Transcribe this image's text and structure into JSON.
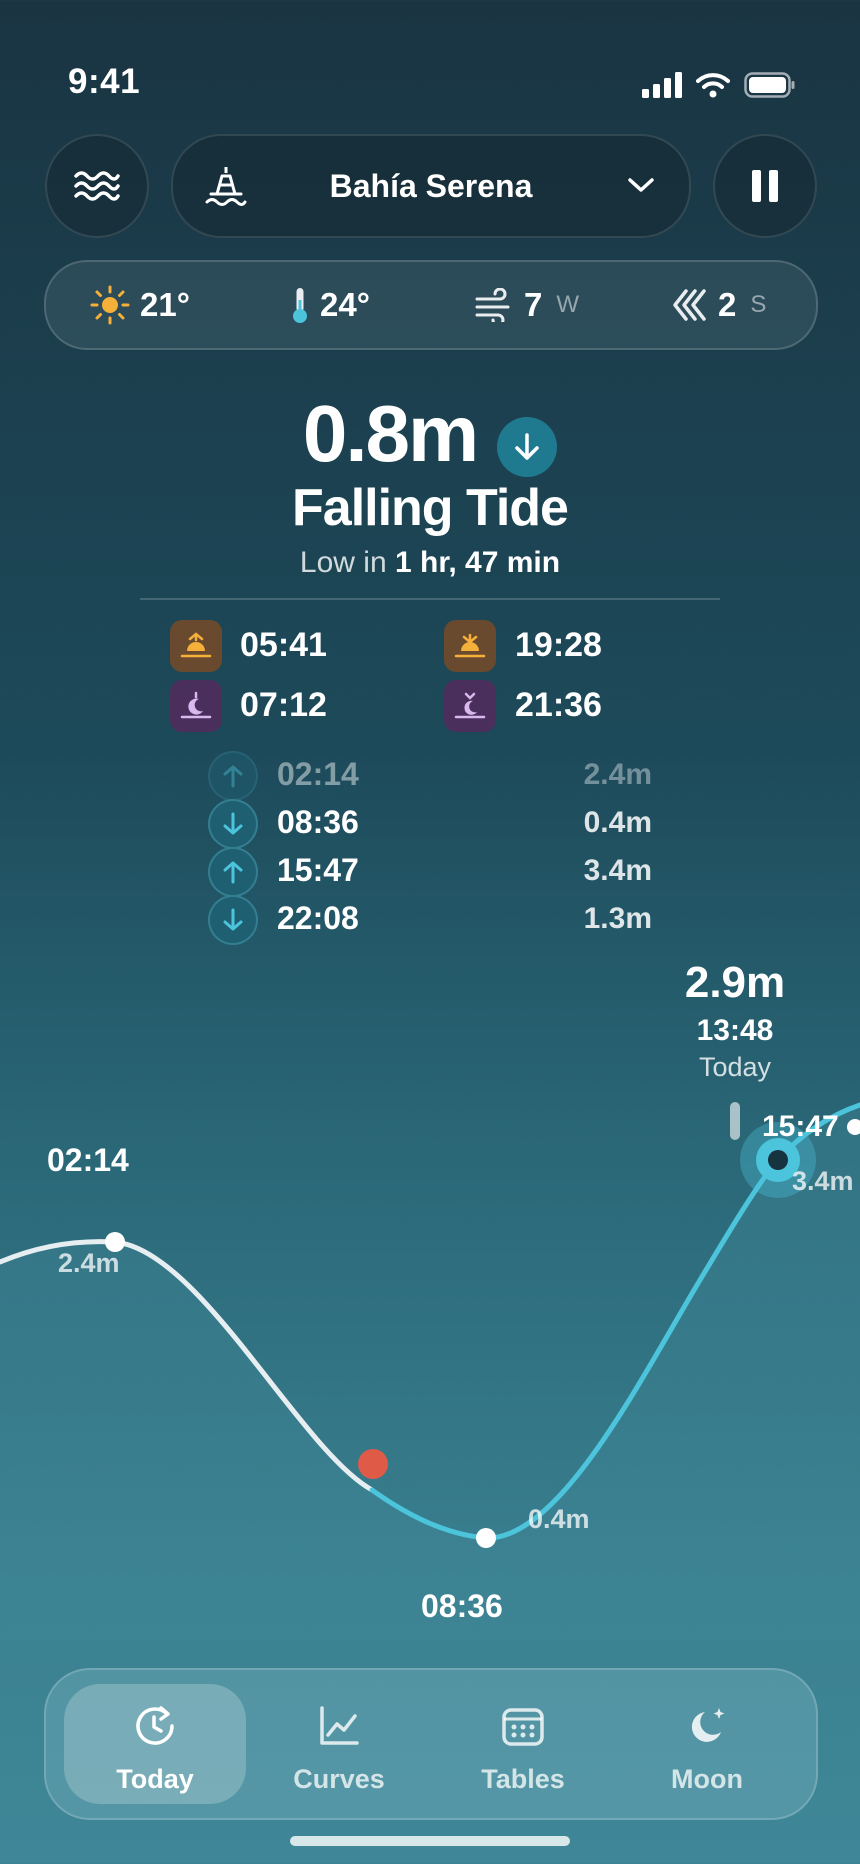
{
  "status": {
    "time": "9:41"
  },
  "location": {
    "name": "Bahía Serena"
  },
  "weather": {
    "air_temp": "21°",
    "water_temp": "24°",
    "wind_speed": "7",
    "wind_dir": "W",
    "swell": "2",
    "swell_dir": "S"
  },
  "current": {
    "height": "0.8m",
    "state": "Falling Tide",
    "next_prefix": "Low in",
    "next_value": "1 hr, 47 min"
  },
  "sun_moon": {
    "sunrise": "05:41",
    "sunset": "19:28",
    "moonrise": "07:12",
    "moonset": "21:36"
  },
  "tides": [
    {
      "direction": "up",
      "time": "02:14",
      "height": "2.4m",
      "past": true
    },
    {
      "direction": "down",
      "time": "08:36",
      "height": "0.4m",
      "past": false
    },
    {
      "direction": "up",
      "time": "15:47",
      "height": "3.4m",
      "past": false
    },
    {
      "direction": "down",
      "time": "22:08",
      "height": "1.3m",
      "past": false
    }
  ],
  "chart": {
    "scrub_height": "2.9m",
    "scrub_time": "13:48",
    "scrub_day": "Today",
    "high1_time": "02:14",
    "high1_height": "2.4m",
    "low_time": "08:36",
    "low_height": "0.4m",
    "high2_time": "15:47",
    "high2_height": "3.4m"
  },
  "chart_data": {
    "type": "line",
    "x": [
      "02:14",
      "08:36",
      "15:47"
    ],
    "y": [
      2.4,
      0.4,
      3.4
    ],
    "now_marker": "07:54"
  },
  "tabs": [
    {
      "label": "Today",
      "icon": "clock-refresh-icon",
      "active": true
    },
    {
      "label": "Curves",
      "icon": "line-chart-icon",
      "active": false
    },
    {
      "label": "Tables",
      "icon": "calendar-icon",
      "active": false
    },
    {
      "label": "Moon",
      "icon": "moon-stars-icon",
      "active": false
    }
  ],
  "colors": {
    "accent": "#4cc4dc",
    "now_marker": "#e05a48",
    "sun": "#f5b03a",
    "moon": "#d9b8f0"
  }
}
